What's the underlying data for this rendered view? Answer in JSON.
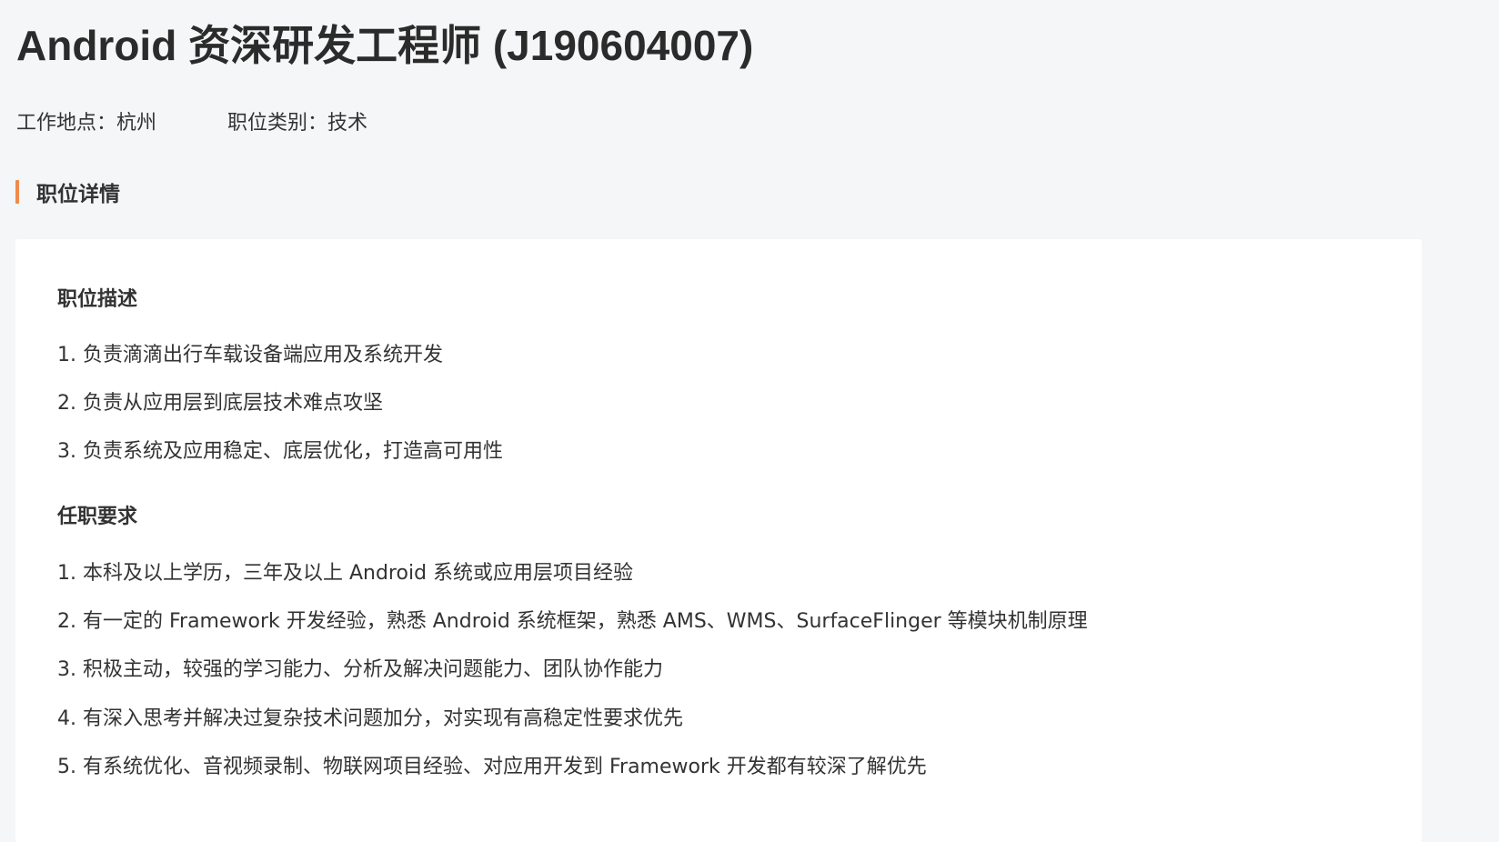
{
  "job": {
    "title": "Android 资深研发工程师 (J190604007)",
    "meta": {
      "location": "工作地点：杭州",
      "category": "职位类别：技术"
    },
    "details_section_title": "职位详情",
    "description": {
      "heading": "职位描述",
      "items": [
        "1. 负责滴滴出行车载设备端应用及系统开发",
        "2. 负责从应用层到底层技术难点攻坚",
        "3. 负责系统及应用稳定、底层优化，打造高可用性"
      ]
    },
    "requirements": {
      "heading": "任职要求",
      "items": [
        "1. 本科及以上学历，三年及以上 Android 系统或应用层项目经验",
        "2. 有一定的 Framework 开发经验，熟悉 Android 系统框架，熟悉 AMS、WMS、SurfaceFlinger 等模块机制原理",
        "3. 积极主动，较强的学习能力、分析及解决问题能力、团队协作能力",
        "4. 有深入思考并解决过复杂技术问题加分，对实现有高稳定性要求优先",
        "5. 有系统优化、音视频录制、物联网项目经验、对应用开发到 Framework 开发都有较深了解优先"
      ]
    }
  },
  "colors": {
    "page_background": "#f5f6f7",
    "card_background": "#ffffff",
    "accent": "#f08a4b",
    "text": "#333333",
    "title_text": "#2b2b2b"
  }
}
